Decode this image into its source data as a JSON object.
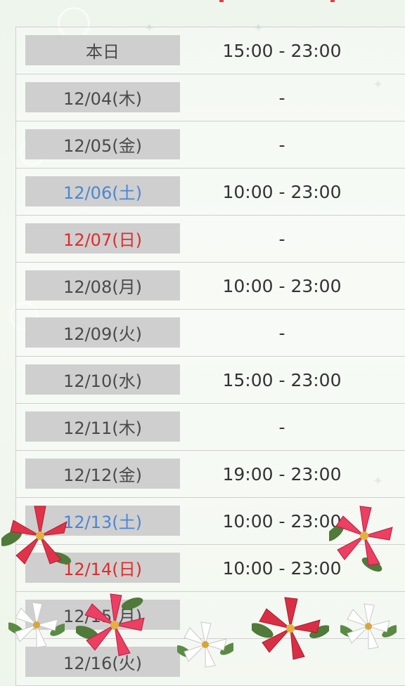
{
  "schedule": [
    {
      "date": "本日",
      "time": "15:00 - 23:00",
      "kind": "normal"
    },
    {
      "date": "12/04(木)",
      "time": "-",
      "kind": "normal"
    },
    {
      "date": "12/05(金)",
      "time": "-",
      "kind": "normal"
    },
    {
      "date": "12/06(土)",
      "time": "10:00 - 23:00",
      "kind": "sat"
    },
    {
      "date": "12/07(日)",
      "time": "-",
      "kind": "sun"
    },
    {
      "date": "12/08(月)",
      "time": "10:00 - 23:00",
      "kind": "normal"
    },
    {
      "date": "12/09(火)",
      "time": "-",
      "kind": "normal"
    },
    {
      "date": "12/10(水)",
      "time": "15:00 - 23:00",
      "kind": "normal"
    },
    {
      "date": "12/11(木)",
      "time": "-",
      "kind": "normal"
    },
    {
      "date": "12/12(金)",
      "time": "19:00 - 23:00",
      "kind": "normal"
    },
    {
      "date": "12/13(土)",
      "time": "10:00 - 23:00",
      "kind": "sat"
    },
    {
      "date": "12/14(日)",
      "time": "10:00 - 23:00",
      "kind": "sun"
    },
    {
      "date": "12/15(月)",
      "time": "",
      "kind": "normal"
    },
    {
      "date": "12/16(火)",
      "time": "",
      "kind": "normal"
    }
  ],
  "colors": {
    "saturday": "#4a86d4",
    "sunday": "#e12b2b",
    "date_cell_bg": "#cfcfcf",
    "poinsettia_red": "#e0334a",
    "poinsettia_white": "#ffffff"
  },
  "icons": [
    "poinsettia-red-icon",
    "poinsettia-white-icon",
    "snowflake-icon",
    "sparkle-icon"
  ]
}
